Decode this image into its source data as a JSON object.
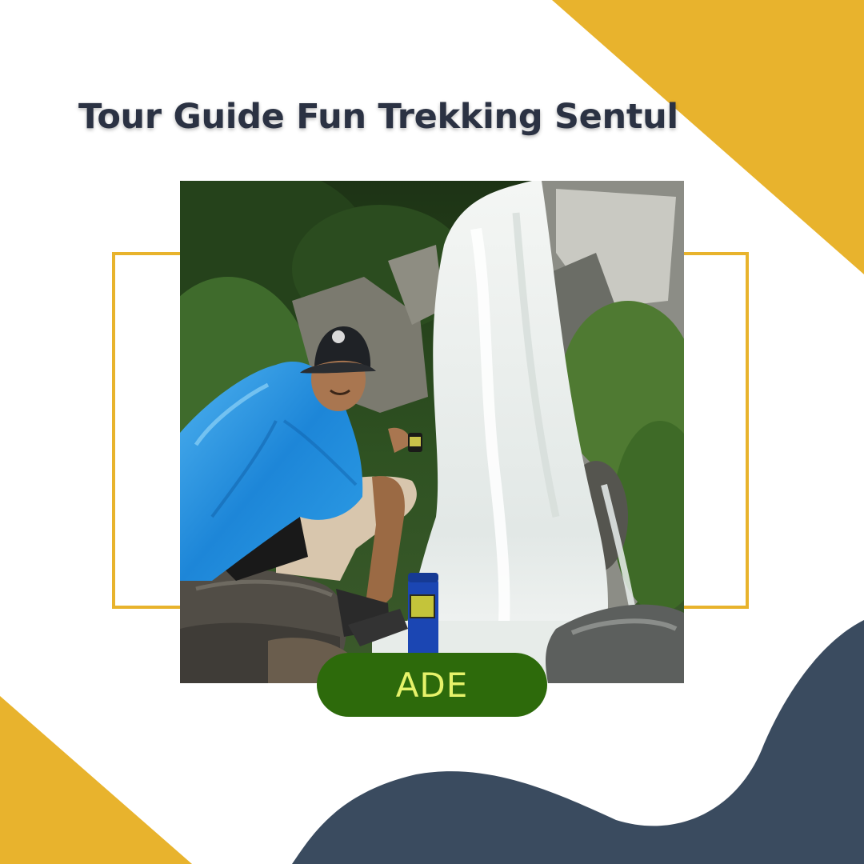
{
  "headline": "Tour Guide Fun Trekking Sentul",
  "guide_name": "ADE",
  "colors": {
    "accent_yellow": "#e8b32d",
    "wave_navy": "#3a4b5f",
    "headline_text": "#2b3243",
    "pill_green": "#2d6a0b",
    "pill_text": "#e6f26a"
  },
  "photo": {
    "subject": "guide-seated-by-waterfall"
  }
}
